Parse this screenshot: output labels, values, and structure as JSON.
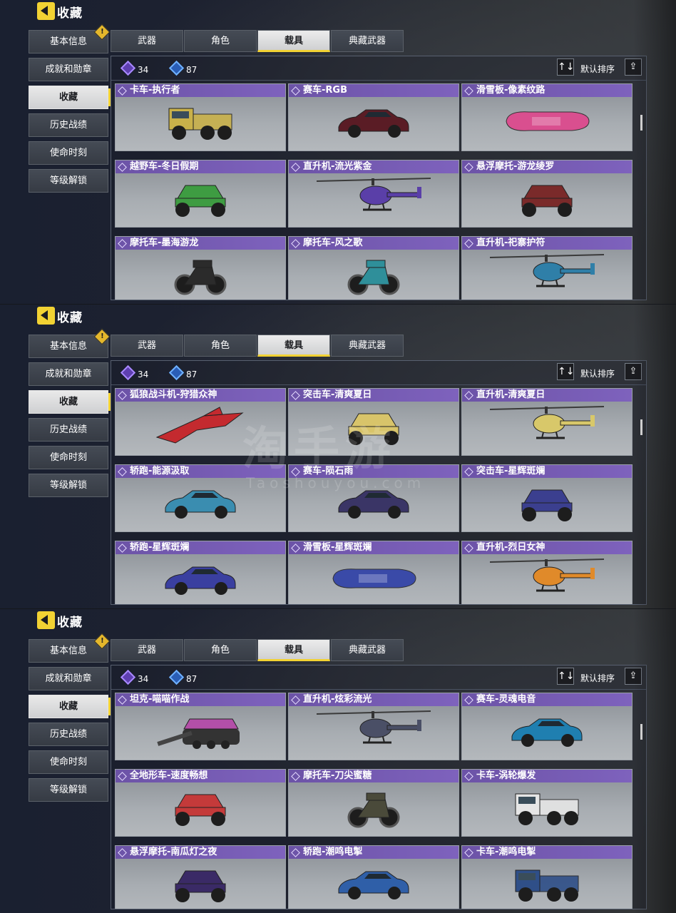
{
  "panels": [
    {
      "title": "收藏",
      "sidebar": [
        "基本信息",
        "成就和勋章",
        "收藏",
        "历史战绩",
        "使命时刻",
        "等级解锁"
      ],
      "active_sidebar": 2,
      "alert_mark": "!",
      "tabs": [
        "武器",
        "角色",
        "载具",
        "典藏武器"
      ],
      "active_tab": 2,
      "currency_purple": "34",
      "currency_blue": "87",
      "sort_label": "默认排序",
      "sort_icon": "↑↓",
      "share_icon": "⇪",
      "cards": [
        {
          "name": "卡车-执行者",
          "icon": "truck",
          "color": "#c9b14a"
        },
        {
          "name": "赛车-RGB",
          "icon": "car",
          "color": "#5a1c25"
        },
        {
          "name": "滑雪板-像素纹路",
          "icon": "board",
          "color": "#d94f8f"
        },
        {
          "name": "越野车-冬日假期",
          "icon": "buggy",
          "color": "#3e9c42"
        },
        {
          "name": "直升机-流光紫金",
          "icon": "heli",
          "color": "#5a3fa8"
        },
        {
          "name": "悬浮摩托-游龙绫罗",
          "icon": "hover",
          "color": "#7a2a2a"
        },
        {
          "name": "摩托车-墨海游龙",
          "icon": "moto",
          "color": "#2b2b2b"
        },
        {
          "name": "摩托车-风之歌",
          "icon": "moto",
          "color": "#2f8f9a"
        },
        {
          "name": "直升机-祀寨护符",
          "icon": "heli",
          "color": "#2f7fa8"
        }
      ]
    },
    {
      "title": "收藏",
      "sidebar": [
        "基本信息",
        "成就和勋章",
        "收藏",
        "历史战绩",
        "使命时刻",
        "等级解锁"
      ],
      "active_sidebar": 2,
      "alert_mark": "!",
      "tabs": [
        "武器",
        "角色",
        "载具",
        "典藏武器"
      ],
      "active_tab": 2,
      "currency_purple": "34",
      "currency_blue": "87",
      "sort_label": "默认排序",
      "sort_icon": "↑↓",
      "share_icon": "⇪",
      "cards": [
        {
          "name": "狐狼战斗机-狩猎众神",
          "icon": "jet",
          "color": "#c42a2f"
        },
        {
          "name": "突击车-清爽夏日",
          "icon": "buggy",
          "color": "#d8c46a"
        },
        {
          "name": "直升机-清爽夏日",
          "icon": "heli",
          "color": "#d8c86a"
        },
        {
          "name": "轿跑-能源汲取",
          "icon": "car",
          "color": "#3a8db0"
        },
        {
          "name": "赛车-陨石雨",
          "icon": "car",
          "color": "#3a3566"
        },
        {
          "name": "突击车-星辉斑斓",
          "icon": "buggy",
          "color": "#3b3f8f"
        },
        {
          "name": "轿跑-星辉斑斓",
          "icon": "car",
          "color": "#3a3fa0"
        },
        {
          "name": "滑雪板-星辉斑斓",
          "icon": "board",
          "color": "#3a4aa8"
        },
        {
          "name": "直升机-烈日女神",
          "icon": "heli",
          "color": "#e08a2a"
        }
      ]
    },
    {
      "title": "收藏",
      "sidebar": [
        "基本信息",
        "成就和勋章",
        "收藏",
        "历史战绩",
        "使命时刻",
        "等级解锁"
      ],
      "active_sidebar": 2,
      "alert_mark": "!",
      "tabs": [
        "武器",
        "角色",
        "载具",
        "典藏武器"
      ],
      "active_tab": 2,
      "currency_purple": "34",
      "currency_blue": "87",
      "sort_label": "默认排序",
      "sort_icon": "↑↓",
      "share_icon": "⇪",
      "cards": [
        {
          "name": "坦克-喵喵作战",
          "icon": "tank",
          "color": "#b34fa8"
        },
        {
          "name": "直升机-炫彩流光",
          "icon": "heli",
          "color": "#4a4f66"
        },
        {
          "name": "赛车-灵魂电音",
          "icon": "car",
          "color": "#1f7fb0"
        },
        {
          "name": "全地形车-速度畅想",
          "icon": "buggy",
          "color": "#c43a3a"
        },
        {
          "name": "摩托车-刀尖蜜糖",
          "icon": "moto",
          "color": "#4a4a3a"
        },
        {
          "name": "卡车-涡轮爆发",
          "icon": "truck",
          "color": "#e6e6e6"
        },
        {
          "name": "悬浮摩托-南瓜灯之夜",
          "icon": "hover",
          "color": "#3a2a66"
        },
        {
          "name": "轿跑-潮鸣电掣",
          "icon": "car",
          "color": "#2f5fa8"
        },
        {
          "name": "卡车-潮鸣电掣",
          "icon": "truck",
          "color": "#2f4f88"
        }
      ]
    }
  ],
  "watermark": {
    "main": "淘手游",
    "sub": "Taoshouyou.com"
  }
}
